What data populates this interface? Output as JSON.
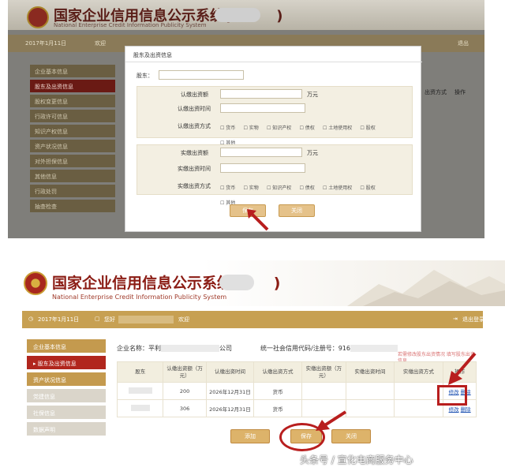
{
  "panel1": {
    "title": "国家企业信用信息公示系统(",
    "title_close": ")",
    "subtitle": "National Enterprise Credit Information Publicity System",
    "bar": {
      "date": "2017年1月11日",
      "user": "欢迎",
      "logout": "退出"
    },
    "sidebar": [
      "企业基本信息",
      "股东及出资信息",
      "股权变更信息",
      "行政许可信息",
      "知识产权信息",
      "资产状况信息",
      "对外担保信息",
      "其他信息",
      "行政处罚",
      "抽查检查",
      "年报信息"
    ],
    "bg_table_cells": [
      "出资方式",
      "操作"
    ],
    "dialog": {
      "title": "股东及出资信息",
      "shareholder_label": "股东：",
      "sub_amount_label": "认缴出资额",
      "sub_time_label": "认缴出资时间",
      "sub_method_label": "认缴出资方式",
      "act_amount_label": "实缴出资额",
      "act_time_label": "实缴出资时间",
      "act_method_label": "实缴出资方式",
      "unit": "万元",
      "methods": [
        "货币",
        "实物",
        "知识产权",
        "债权",
        "土地使用权",
        "股权",
        "其他"
      ],
      "save": "保存",
      "close": "关闭"
    }
  },
  "panel2": {
    "title": "国家企业信用信息公示系统(",
    "title_close": ")",
    "subtitle": "National Enterprise Credit Information Publicity System",
    "bar": {
      "date": "2017年1月11日",
      "user": "您好",
      "logout": "退出",
      "welcome": "欢迎",
      "logout_label": "退出登录"
    },
    "sidebar": [
      {
        "label": "企业基本信息",
        "bg": "#c49a4e"
      },
      {
        "label": "▸ 股东及出资信息",
        "bg": "#b1261d"
      },
      {
        "label": "资产状况信息",
        "bg": "#c49a4e"
      },
      {
        "label": "党建信息",
        "bg": "#dad5ca"
      },
      {
        "label": "社保信息",
        "bg": "#dad5ca"
      },
      {
        "label": "数据声明",
        "bg": "#dad5ca"
      }
    ],
    "company_label": "企业名称：",
    "company_value": "平利",
    "company_suffix": "公司",
    "credit_label": "统一社会信用代码/注册号：",
    "credit_value": "916",
    "annotation": "若需修改股东出资情况 填写股东出资信息",
    "table": {
      "headers": [
        "股东",
        "认缴出资额（万元）",
        "认缴出资时间",
        "认缴出资方式",
        "实缴出资额（万元）",
        "实缴出资时间",
        "实缴出资方式",
        "操作"
      ],
      "rows": [
        {
          "amount": "200",
          "time": "2026年12月31日",
          "method": "货币",
          "edit": "修改",
          "del": "删除"
        },
        {
          "amount": "306",
          "time": "2026年12月31日",
          "method": "货币",
          "edit": "修改",
          "del": "删除"
        }
      ]
    },
    "buttons": {
      "add": "添加",
      "save": "保存",
      "close": "关闭"
    },
    "watermark": "头条号 / 宣化电商服务中心"
  },
  "colors": {
    "gold": "#c7a052",
    "red": "#b1261d",
    "arrow": "#b81e1e"
  }
}
